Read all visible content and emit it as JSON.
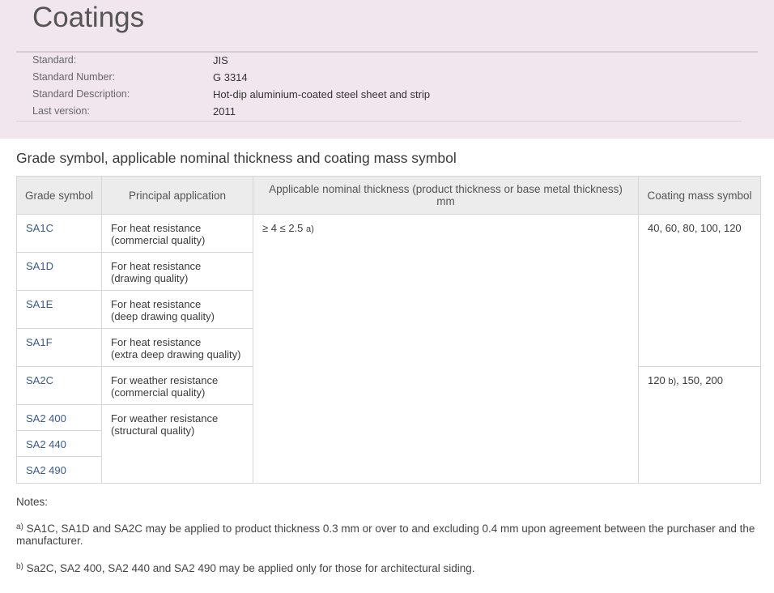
{
  "header": {
    "title": "Coatings",
    "meta": [
      {
        "label": "Standard:",
        "value": "JIS"
      },
      {
        "label": "Standard Number:",
        "value": "G 3314"
      },
      {
        "label": "Standard Description:",
        "value": "Hot-dip aluminium-coated steel sheet and strip"
      },
      {
        "label": "Last version:",
        "value": "2011"
      }
    ]
  },
  "section_title": "Grade symbol, applicable nominal thickness and coating mass symbol",
  "table": {
    "headers": {
      "grade": "Grade symbol",
      "application": "Principal application",
      "thickness_line1": "Applicable nominal thickness (product thickness or base metal thickness)",
      "thickness_line2": "mm",
      "coating": "Coating mass symbol"
    },
    "grades": [
      "SA1C",
      "SA1D",
      "SA1E",
      "SA1F",
      "SA2C",
      "SA2 400",
      "SA2 440",
      "SA2 490"
    ],
    "applications": [
      {
        "line1": "For heat resistance",
        "line2": "(commercial quality)"
      },
      {
        "line1": "For heat resistance",
        "line2": "(drawing quality)"
      },
      {
        "line1": "For heat resistance",
        "line2": "(deep drawing quality)"
      },
      {
        "line1": "For heat resistance",
        "line2": "(extra deep drawing quality)"
      },
      {
        "line1": "For weather resistance",
        "line2": "(commercial quality)"
      },
      {
        "line1": "For weather resistance",
        "line2": "(structural quality)"
      }
    ],
    "thickness": {
      "value": "≥ 4 ≤ 2.5",
      "mark": "a)"
    },
    "coating_1": "40, 60, 80, 100, 120",
    "coating_2": {
      "prefix": "120",
      "mark": "b)",
      "suffix": ", 150, 200"
    }
  },
  "notes": {
    "label": "Notes:",
    "a": {
      "mark": "a)",
      "text": "SA1C, SA1D and SA2C may be applied to product thickness 0.3 mm or over to and excluding 0.4 mm upon agreement between the purchaser and the manufacturer."
    },
    "b": {
      "mark": "b)",
      "text": "Sa2C, SA2 400, SA2 440 and SA2 490 may be applied only for those for architectural siding."
    }
  }
}
